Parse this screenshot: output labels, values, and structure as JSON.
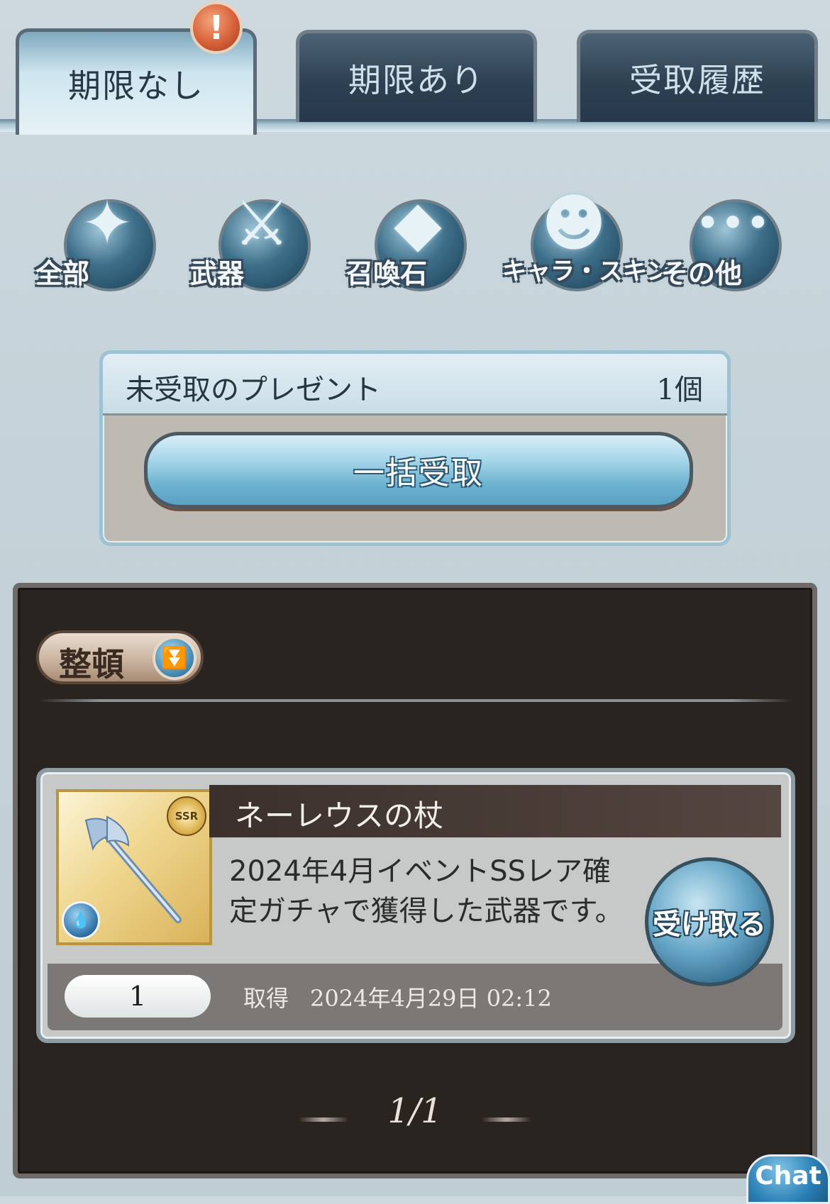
{
  "tabs": [
    {
      "label": "期限なし",
      "active": true
    },
    {
      "label": "期限あり",
      "active": false
    },
    {
      "label": "受取履歴",
      "active": false
    }
  ],
  "tab_badge": "!",
  "categories": [
    {
      "label": "全部",
      "icon": "all-items-icon"
    },
    {
      "label": "武器",
      "icon": "sword-icon"
    },
    {
      "label": "召喚石",
      "icon": "crystal-icon"
    },
    {
      "label": "キャラ・スキン",
      "icon": "character-silhouette-icon"
    },
    {
      "label": "その他",
      "icon": "more-dots-icon"
    }
  ],
  "summary": {
    "title": "未受取のプレゼント",
    "count": "1個",
    "bulk_receive_label": "一括受取"
  },
  "sort": {
    "label": "整頓"
  },
  "items": [
    {
      "name": "ネーレウスの杖",
      "description": "2024年4月イベントSSレア確定ガチャで獲得した武器です。",
      "rarity": "SSR",
      "element": "water",
      "quantity": "1",
      "acquired_label": "取得",
      "acquired_date": "2024年4月29日 02:12",
      "receive_label": "受け取る"
    }
  ],
  "pagination": {
    "label": "1/1"
  },
  "chat": {
    "label": "Chat"
  }
}
